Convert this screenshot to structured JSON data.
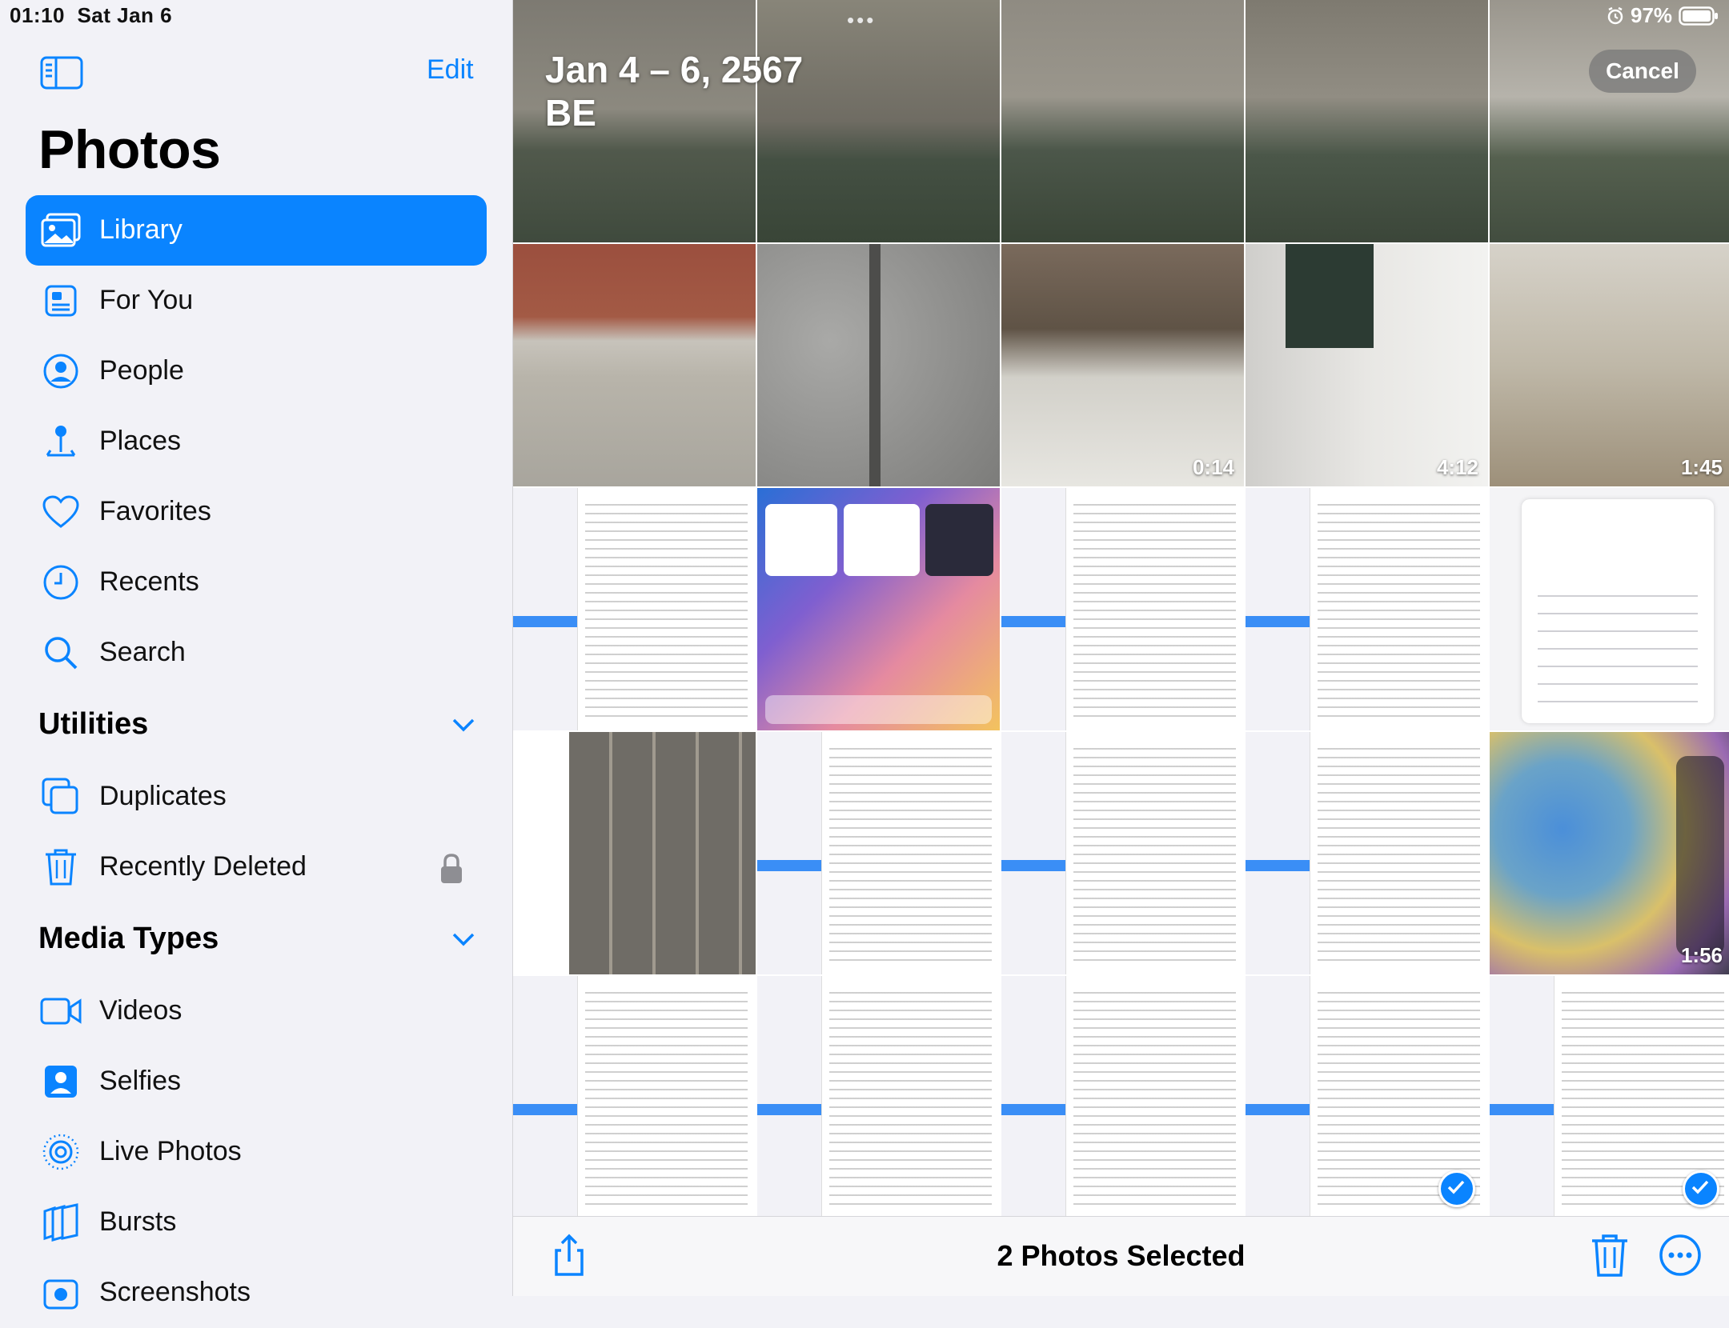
{
  "status_bar": {
    "time": "01:10",
    "date": "Sat Jan 6",
    "battery": "97%"
  },
  "sidebar": {
    "edit": "Edit",
    "title": "Photos",
    "items": [
      {
        "label": "Library",
        "icon": "photo-library-icon",
        "active": true
      },
      {
        "label": "For You",
        "icon": "for-you-icon"
      },
      {
        "label": "People",
        "icon": "person-circle-icon"
      },
      {
        "label": "Places",
        "icon": "map-pin-icon"
      },
      {
        "label": "Favorites",
        "icon": "heart-icon"
      },
      {
        "label": "Recents",
        "icon": "clock-icon"
      },
      {
        "label": "Search",
        "icon": "search-icon"
      }
    ],
    "utilities": {
      "header": "Utilities",
      "items": [
        {
          "label": "Duplicates",
          "icon": "duplicates-icon"
        },
        {
          "label": "Recently Deleted",
          "icon": "trash-icon",
          "locked": true
        }
      ]
    },
    "media_types": {
      "header": "Media Types",
      "items": [
        {
          "label": "Videos",
          "icon": "video-icon"
        },
        {
          "label": "Selfies",
          "icon": "selfie-icon"
        },
        {
          "label": "Live Photos",
          "icon": "live-photo-icon"
        },
        {
          "label": "Bursts",
          "icon": "bursts-icon"
        },
        {
          "label": "Screenshots",
          "icon": "screenshot-icon"
        }
      ]
    }
  },
  "main": {
    "date_range": "Jan 4 – 6, 2567",
    "date_era": "BE",
    "more_dots": "•••",
    "cancel": "Cancel",
    "tiles": [
      {
        "kind": "mail1"
      },
      {
        "kind": "mail2"
      },
      {
        "kind": "mail3"
      },
      {
        "kind": "mail4"
      },
      {
        "kind": "mail5"
      },
      {
        "kind": "brick"
      },
      {
        "kind": "concrete"
      },
      {
        "kind": "stairs",
        "duration": "0:14"
      },
      {
        "kind": "wall",
        "duration": "4:12"
      },
      {
        "kind": "room",
        "duration": "1:45"
      },
      {
        "kind": "shot"
      },
      {
        "kind": "home"
      },
      {
        "kind": "shot"
      },
      {
        "kind": "shot"
      },
      {
        "kind": "sheet"
      },
      {
        "kind": "photos"
      },
      {
        "kind": "shot"
      },
      {
        "kind": "shot"
      },
      {
        "kind": "shot"
      },
      {
        "kind": "blur",
        "duration": "1:56"
      },
      {
        "kind": "shot"
      },
      {
        "kind": "shot"
      },
      {
        "kind": "shot"
      },
      {
        "kind": "shot",
        "selected": true
      },
      {
        "kind": "shot",
        "selected": true
      }
    ]
  },
  "toolbar": {
    "selection_text": "2 Photos Selected",
    "icons": [
      "share-icon",
      "trash-icon",
      "more-icon"
    ]
  },
  "colors": {
    "accent": "#0a84ff",
    "sidebar_bg": "#f2f2f7"
  }
}
